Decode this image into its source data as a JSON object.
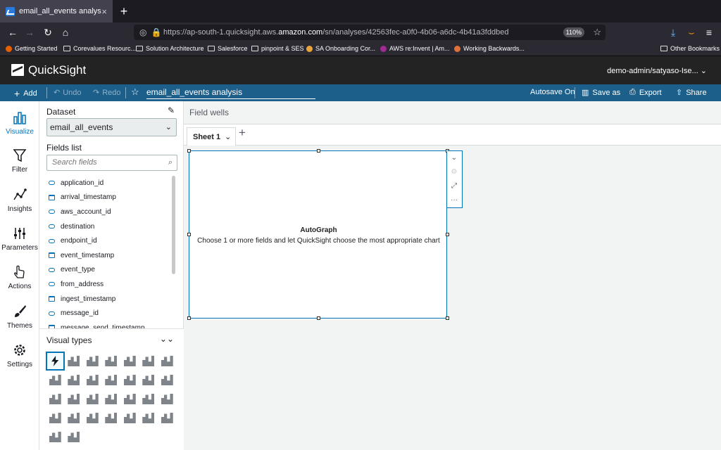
{
  "browser": {
    "tab_title": "email_all_events analysis",
    "tab_close": "×",
    "new_tab": "+",
    "url_prefix": "https://ap-south-1.quicksight.aws.",
    "url_host": "amazon.com",
    "url_path": "/sn/analyses/42563fec-a0f0-4b06-a6dc-4b41a3fddbed",
    "zoom": "110%",
    "bookmarks": [
      "Getting Started",
      "Corevalues Resourc...",
      "Solution Architecture",
      "Salesforce",
      "pinpoint & SES",
      "SA Onboarding Cor...",
      "AWS re:Invent | Am...",
      "Working Backwards..."
    ],
    "other_bookmarks": "Other Bookmarks"
  },
  "app": {
    "name": "QuickSight",
    "user": "demo-admin/satyaso-Ise...",
    "toolbar": {
      "add": "Add",
      "undo": "Undo",
      "redo": "Redo",
      "analysis_title": "email_all_events analysis",
      "autosave": "Autosave On",
      "save_as": "Save as",
      "export": "Export",
      "share": "Share"
    }
  },
  "leftnav": [
    {
      "label": "Visualize",
      "icon": "bar-chart-icon"
    },
    {
      "label": "Filter",
      "icon": "filter-icon"
    },
    {
      "label": "Insights",
      "icon": "insights-icon"
    },
    {
      "label": "Parameters",
      "icon": "sliders-icon"
    },
    {
      "label": "Actions",
      "icon": "click-icon"
    },
    {
      "label": "Themes",
      "icon": "brush-icon"
    },
    {
      "label": "Settings",
      "icon": "gear-icon"
    }
  ],
  "panel": {
    "dataset_label": "Dataset",
    "dataset_value": "email_all_events",
    "fields_label": "Fields list",
    "search_placeholder": "Search fields",
    "fields": [
      {
        "name": "application_id",
        "kind": "string"
      },
      {
        "name": "arrival_timestamp",
        "kind": "date"
      },
      {
        "name": "aws_account_id",
        "kind": "string"
      },
      {
        "name": "destination",
        "kind": "string"
      },
      {
        "name": "endpoint_id",
        "kind": "string"
      },
      {
        "name": "event_timestamp",
        "kind": "date"
      },
      {
        "name": "event_type",
        "kind": "string"
      },
      {
        "name": "from_address",
        "kind": "string"
      },
      {
        "name": "ingest_timestamp",
        "kind": "date"
      },
      {
        "name": "message_id",
        "kind": "string"
      },
      {
        "name": "message_send_timestamp",
        "kind": "date"
      }
    ],
    "visual_types_label": "Visual types"
  },
  "main": {
    "field_wells": "Field wells",
    "sheet_tab": "Sheet 1",
    "visual": {
      "title": "AutoGraph",
      "subtitle": "Choose 1 or more fields and let QuickSight choose the most appropriate chart"
    }
  },
  "colors": {
    "toolbar": "#1d5f8b",
    "header": "#232323",
    "accent": "#0073bb"
  }
}
